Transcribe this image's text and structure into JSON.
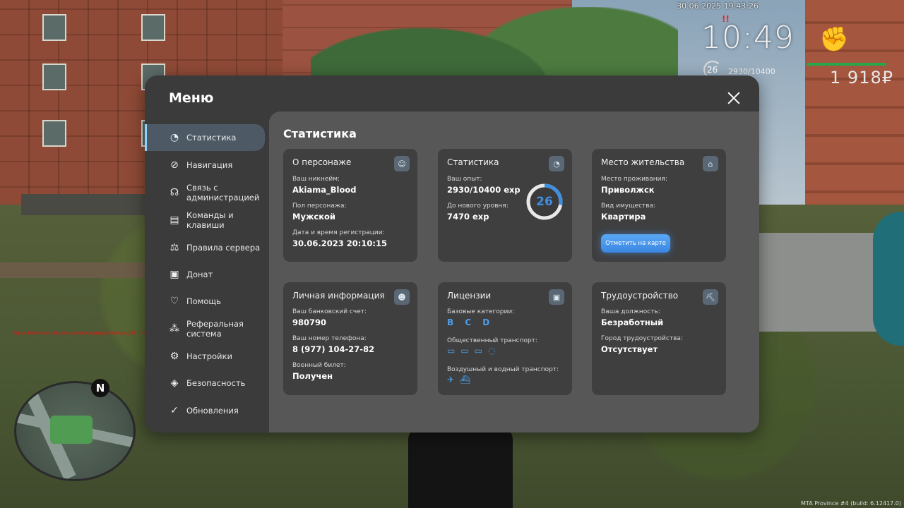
{
  "hud": {
    "datetime": "30.06.2025 19:43:26",
    "time": "10:49",
    "level": "26",
    "exp": "2930/10400",
    "money": "1 918₽",
    "alert": "!!",
    "chat_line": "Игрок Takoy был забанен администратором Kasuro_Ott (7 мес.) (Читы)",
    "build": "MTA Province #4 (build: 6.12417.0)",
    "minimap_north": "N"
  },
  "menu": {
    "title": "Меню",
    "close_icon": "close-icon",
    "sidebar": [
      {
        "label": "Статистика",
        "icon": "◔",
        "active": true
      },
      {
        "label": "Навигация",
        "icon": "⊘"
      },
      {
        "label": "Связь с администрацией",
        "icon": "☊"
      },
      {
        "label": "Команды и клавиши",
        "icon": "▤"
      },
      {
        "label": "Правила сервера",
        "icon": "⚖"
      },
      {
        "label": "Донат",
        "icon": "▣"
      },
      {
        "label": "Помощь",
        "icon": "♡"
      },
      {
        "label": "Реферальная система",
        "icon": "⁂"
      },
      {
        "label": "Настройки",
        "icon": "⚙"
      },
      {
        "label": "Безопасность",
        "icon": "◈"
      },
      {
        "label": "Обновления",
        "icon": "✓"
      }
    ]
  },
  "content": {
    "title": "Статистика",
    "character": {
      "title": "О персонаже",
      "nickname_label": "Ваш никнейм:",
      "nickname": "Akiama_Blood",
      "gender_label": "Пол персонажа:",
      "gender": "Мужской",
      "reg_label": "Дата и время регистрации:",
      "reg": "30.06.2023 20:10:15"
    },
    "stats": {
      "title": "Статистика",
      "exp_label": "Ваш опыт:",
      "exp": "2930/10400 exp",
      "next_label": "До нового уровня:",
      "next": "7470 exp",
      "level": "26",
      "progress": 0.28
    },
    "residence": {
      "title": "Место жительства",
      "place_label": "Место проживания:",
      "place": "Приволжск",
      "property_label": "Вид имущества:",
      "property": "Квартира",
      "map_button": "Отметить на карте"
    },
    "personal": {
      "title": "Личная информация",
      "bank_label": "Ваш банковский счет:",
      "bank": "980790",
      "phone_label": "Ваш номер телефона:",
      "phone": "8 (977) 104-27-82",
      "military_label": "Военный билет:",
      "military": "Получен"
    },
    "licenses": {
      "title": "Лицензии",
      "base_label": "Базовые категории:",
      "base": "B C D",
      "public_label": "Общественный транспорт:",
      "air_label": "Воздушный и водный транспорт:"
    },
    "employment": {
      "title": "Трудоустройство",
      "position_label": "Ваша должность:",
      "position": "Безработный",
      "city_label": "Город трудоустройства:",
      "city": "Отсутствует"
    }
  }
}
